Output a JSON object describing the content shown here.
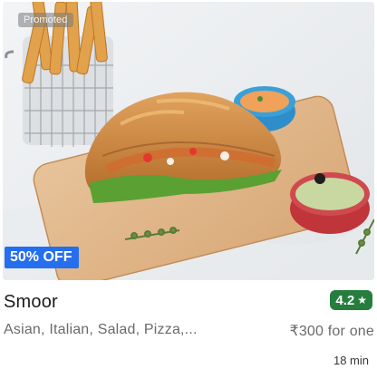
{
  "restaurant": {
    "name": "Smoor",
    "promoted_label": "Promoted",
    "offer_label": "50% OFF",
    "rating": "4.2",
    "rating_icon": "star-icon",
    "cuisines": "Asian, Italian, Salad, Pizza,...",
    "price": "₹300 for one",
    "delivery_time": "18 min"
  },
  "colors": {
    "offer_badge": "#256fef",
    "rating_badge": "#267e3e",
    "promoted_badge": "#8a8a8a"
  }
}
